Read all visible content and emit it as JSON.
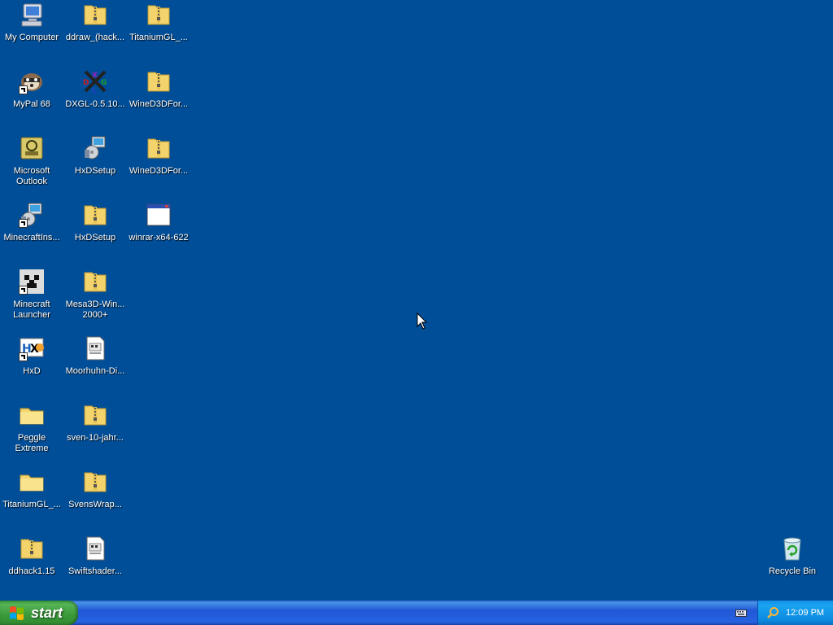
{
  "desktop": {
    "icons": [
      {
        "label": "My Computer"
      },
      {
        "label": "ddraw_(hack..."
      },
      {
        "label": "TitaniumGL_..."
      },
      {
        "label": "MyPal 68"
      },
      {
        "label": "DXGL-0.5.10..."
      },
      {
        "label": "WineD3DFor..."
      },
      {
        "label": "Microsoft\nOutlook"
      },
      {
        "label": "HxDSetup"
      },
      {
        "label": "WineD3DFor..."
      },
      {
        "label": "MinecraftIns..."
      },
      {
        "label": "HxDSetup"
      },
      {
        "label": "winrar-x64-622"
      },
      {
        "label": "Minecraft\nLauncher"
      },
      {
        "label": "Mesa3D-Win...\n2000+"
      },
      {
        "label": "HxD"
      },
      {
        "label": "Moorhuhn-Di..."
      },
      {
        "label": "Peggle\nExtreme"
      },
      {
        "label": "sven-10-jahr..."
      },
      {
        "label": "TitaniumGL_..."
      },
      {
        "label": "SvensWrap..."
      },
      {
        "label": "ddhack1.15"
      },
      {
        "label": "Swiftshader..."
      },
      {
        "label": "Recycle Bin"
      }
    ]
  },
  "taskbar": {
    "start_label": "start",
    "clock": "12:09 PM",
    "colors": {
      "desktop": "#004e98",
      "taskbar": "#2157d7",
      "start": "#3a9a3a",
      "tray": "#0c8ae0"
    }
  }
}
